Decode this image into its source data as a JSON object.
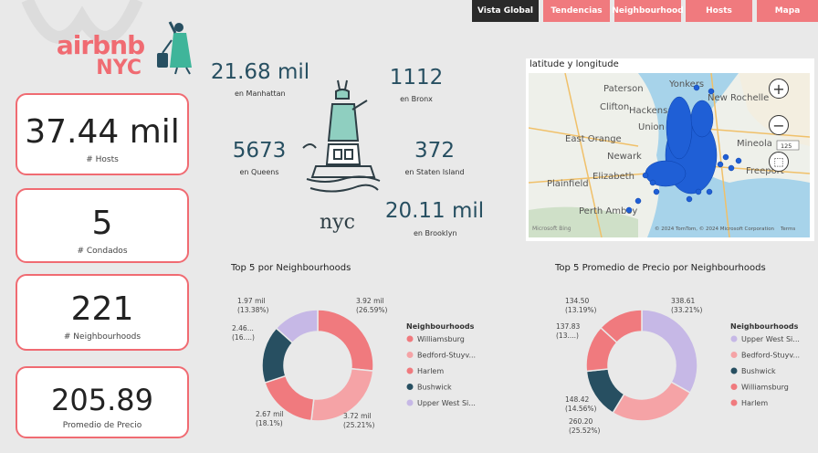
{
  "nav": {
    "tabs": [
      {
        "label": "Vista Global",
        "active": true
      },
      {
        "label": "Tendencias",
        "active": false
      },
      {
        "label": "Neighbourhood",
        "active": false
      },
      {
        "label": "Hosts",
        "active": false
      },
      {
        "label": "Mapa",
        "active": false
      }
    ]
  },
  "brand": {
    "logo_line1": "airbnb",
    "logo_line2": "NYC",
    "accent_color": "#f06b72",
    "dark_color": "#274f61"
  },
  "kpis": [
    {
      "value": "37.44 mil",
      "label": "# Hosts"
    },
    {
      "value": "5",
      "label": "# Condados"
    },
    {
      "value": "221",
      "label": "# Neighbourhoods"
    },
    {
      "value": "205.89",
      "label": "Promedio de Precio"
    }
  ],
  "boroughs": [
    {
      "value": "21.68 mil",
      "label": "en Manhattan"
    },
    {
      "value": "1112",
      "label": "en Bronx"
    },
    {
      "value": "5673",
      "label": "en Queens"
    },
    {
      "value": "372",
      "label": "en Staten Island"
    },
    {
      "value": "20.11 mil",
      "label": "en Brooklyn"
    }
  ],
  "map": {
    "title": "latitude y longitude",
    "labels": [
      "Paterson",
      "Yonkers",
      "Clifton",
      "Hackensack",
      "New Rochelle",
      "Union City",
      "East Orange",
      "Newark",
      "Mineola",
      "Freeport",
      "Plainfield",
      "Elizabeth",
      "Perth Amboy"
    ],
    "copyright": "© 2024 TomTom, © 2024 Microsoft Corporation",
    "terms": "Terms",
    "provider": "Microsoft Bing",
    "road_marker": "125"
  },
  "chart_data": [
    {
      "type": "pie",
      "title": "Top 5 por Neighbourhoods",
      "legend_title": "Neighbourhoods",
      "legend_placement": "right",
      "categories": [
        "Williamsburg",
        "Bedford-Stuyv...",
        "Harlem",
        "Bushwick",
        "Upper West Si..."
      ],
      "values": [
        3920,
        3720,
        2670,
        2460,
        1970
      ],
      "percents": [
        26.59,
        25.21,
        18.1,
        16.0,
        13.38
      ],
      "data_labels": [
        "3.92 mil (26.59%)",
        "3.72 mil (25.21%)",
        "2.67 mil (18.1%)",
        "2.46... (16....)",
        "1.97 mil (13.38%)"
      ],
      "colors": [
        "#f07a7e",
        "#f5a3a6",
        "#f07a7e",
        "#274f61",
        "#c6b8e6"
      ]
    },
    {
      "type": "pie",
      "title": "Top 5 Promedio de Precio por Neighbourhoods",
      "legend_title": "Neighbourhoods",
      "legend_placement": "right",
      "categories": [
        "Upper West Si...",
        "Bedford-Stuyv...",
        "Bushwick",
        "Williamsburg",
        "Harlem"
      ],
      "values": [
        338.61,
        260.2,
        148.42,
        137.83,
        134.5
      ],
      "percents": [
        33.21,
        25.52,
        14.56,
        13.5,
        13.19
      ],
      "data_labels": [
        "338.61 (33.21%)",
        "260.20 (25.52%)",
        "148.42 (14.56%)",
        "137.83 (13....)",
        "134.50 (13.19%)"
      ],
      "colors": [
        "#c6b8e6",
        "#f5a3a6",
        "#274f61",
        "#f07a7e",
        "#f07a7e"
      ]
    }
  ]
}
